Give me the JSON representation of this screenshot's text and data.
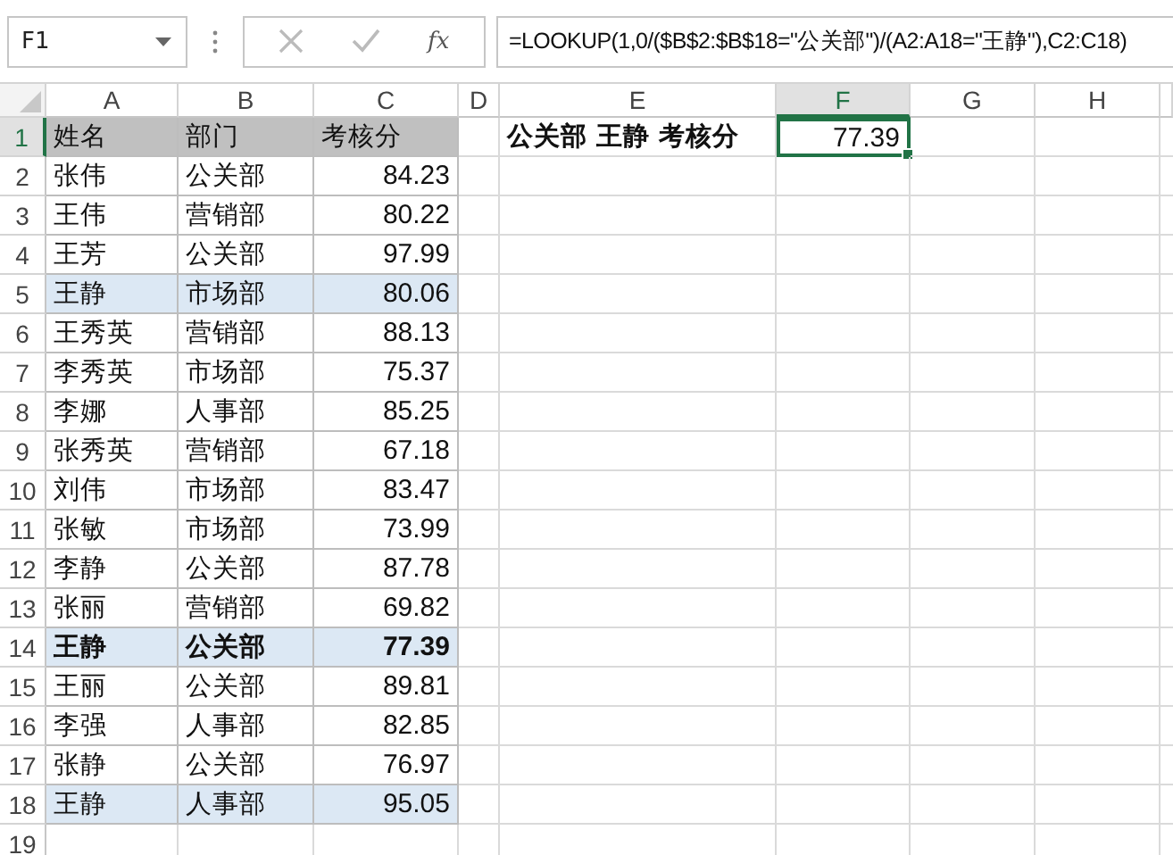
{
  "formula_bar": {
    "name_box": "F1",
    "function_label": "fx",
    "formula": "=LOOKUP(1,0/($B$2:$B$18=\"公关部\")/(A2:A18=\"王静\"),C2:C18)"
  },
  "column_headers": [
    {
      "label": "A",
      "selected": false
    },
    {
      "label": "B",
      "selected": false
    },
    {
      "label": "C",
      "selected": false
    },
    {
      "label": "D",
      "selected": false
    },
    {
      "label": "E",
      "selected": false
    },
    {
      "label": "F",
      "selected": true
    },
    {
      "label": "G",
      "selected": false
    },
    {
      "label": "H",
      "selected": false
    }
  ],
  "header_row": {
    "number": "1",
    "selected": true,
    "cells": [
      "姓名",
      "部门",
      "考核分"
    ]
  },
  "lookup": {
    "label": "公关部  王静 考核分",
    "result": "77.39",
    "selected": true
  },
  "rows": [
    {
      "number": "2",
      "cells": [
        "张伟",
        "公关部",
        "84.23"
      ],
      "highlighted": false,
      "bold": false
    },
    {
      "number": "3",
      "cells": [
        "王伟",
        "营销部",
        "80.22"
      ],
      "highlighted": false,
      "bold": false
    },
    {
      "number": "4",
      "cells": [
        "王芳",
        "公关部",
        "97.99"
      ],
      "highlighted": false,
      "bold": false
    },
    {
      "number": "5",
      "cells": [
        "王静",
        "市场部",
        "80.06"
      ],
      "highlighted": true,
      "bold": false
    },
    {
      "number": "6",
      "cells": [
        "王秀英",
        "营销部",
        "88.13"
      ],
      "highlighted": false,
      "bold": false
    },
    {
      "number": "7",
      "cells": [
        "李秀英",
        "市场部",
        "75.37"
      ],
      "highlighted": false,
      "bold": false
    },
    {
      "number": "8",
      "cells": [
        "李娜",
        "人事部",
        "85.25"
      ],
      "highlighted": false,
      "bold": false
    },
    {
      "number": "9",
      "cells": [
        "张秀英",
        "营销部",
        "67.18"
      ],
      "highlighted": false,
      "bold": false
    },
    {
      "number": "10",
      "cells": [
        "刘伟",
        "市场部",
        "83.47"
      ],
      "highlighted": false,
      "bold": false
    },
    {
      "number": "11",
      "cells": [
        "张敏",
        "市场部",
        "73.99"
      ],
      "highlighted": false,
      "bold": false
    },
    {
      "number": "12",
      "cells": [
        "李静",
        "公关部",
        "87.78"
      ],
      "highlighted": false,
      "bold": false
    },
    {
      "number": "13",
      "cells": [
        "张丽",
        "营销部",
        "69.82"
      ],
      "highlighted": false,
      "bold": false
    },
    {
      "number": "14",
      "cells": [
        "王静",
        "公关部",
        "77.39"
      ],
      "highlighted": true,
      "bold": true
    },
    {
      "number": "15",
      "cells": [
        "王丽",
        "公关部",
        "89.81"
      ],
      "highlighted": false,
      "bold": false
    },
    {
      "number": "16",
      "cells": [
        "李强",
        "人事部",
        "82.85"
      ],
      "highlighted": false,
      "bold": false
    },
    {
      "number": "17",
      "cells": [
        "张静",
        "公关部",
        "76.97"
      ],
      "highlighted": false,
      "bold": false
    },
    {
      "number": "18",
      "cells": [
        "王静",
        "人事部",
        "95.05"
      ],
      "highlighted": true,
      "bold": false
    }
  ],
  "empty_row_numbers": [
    "19"
  ]
}
